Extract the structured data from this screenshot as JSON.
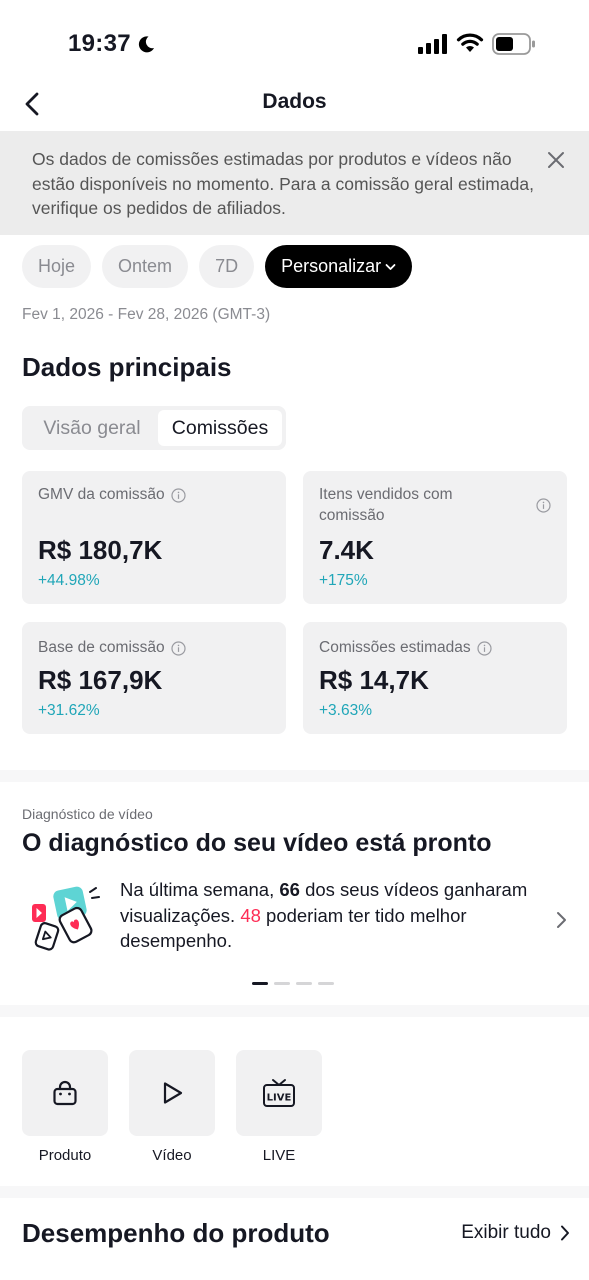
{
  "status_bar": {
    "time": "19:37"
  },
  "header": {
    "title": "Dados"
  },
  "notice": {
    "text": "Os dados de comissões estimadas por produtos e vídeos não estão disponíveis no momento. Para a comissão geral estimada, verifique os pedidos de afiliados."
  },
  "date_filters": [
    {
      "label": "Hoje",
      "selected": false
    },
    {
      "label": "Ontem",
      "selected": false
    },
    {
      "label": "7D",
      "selected": false
    },
    {
      "label": "Personalizar",
      "selected": true
    }
  ],
  "date_range": "Fev 1, 2026 - Fev 28, 2026 (GMT-3)",
  "main_data": {
    "title": "Dados principais",
    "tabs": [
      {
        "label": "Visão geral",
        "selected": false
      },
      {
        "label": "Comissões",
        "selected": true
      }
    ],
    "metrics": [
      {
        "label": "GMV da comissão",
        "value": "R$ 180,7K",
        "delta": "+44.98%"
      },
      {
        "label": "Itens vendidos com comissão",
        "value": "7.4K",
        "delta": "+175%"
      },
      {
        "label": "Base de comissão",
        "value": "R$ 167,9K",
        "delta": "+31.62%"
      },
      {
        "label": "Comissões estimadas",
        "value": "R$ 14,7K",
        "delta": "+3.63%"
      }
    ]
  },
  "diagnostic": {
    "overline": "Diagnóstico de vídeo",
    "title": "O diagnóstico do seu vídeo está pronto",
    "text_part1": "Na última semana, ",
    "highlight_count": "66",
    "text_part2": " dos seus vídeos ganharam visualizações. ",
    "underperform_count": "48",
    "text_part3": " poderiam ter tido melhor desempenho.",
    "page_index": 1,
    "page_count": 4
  },
  "shortcuts": [
    {
      "label": "Produto",
      "icon": "shopping-bag-icon"
    },
    {
      "label": "Vídeo",
      "icon": "play-icon"
    },
    {
      "label": "LIVE",
      "icon": "live-tv-icon"
    }
  ],
  "product_performance": {
    "title": "Desempenho do produto",
    "view_all": "Exibir tudo"
  },
  "colors": {
    "positive_delta": "#20a6b8",
    "highlight_red": "#fe2c55",
    "card_bg": "#f1f1f2",
    "notice_bg": "#ececec"
  }
}
